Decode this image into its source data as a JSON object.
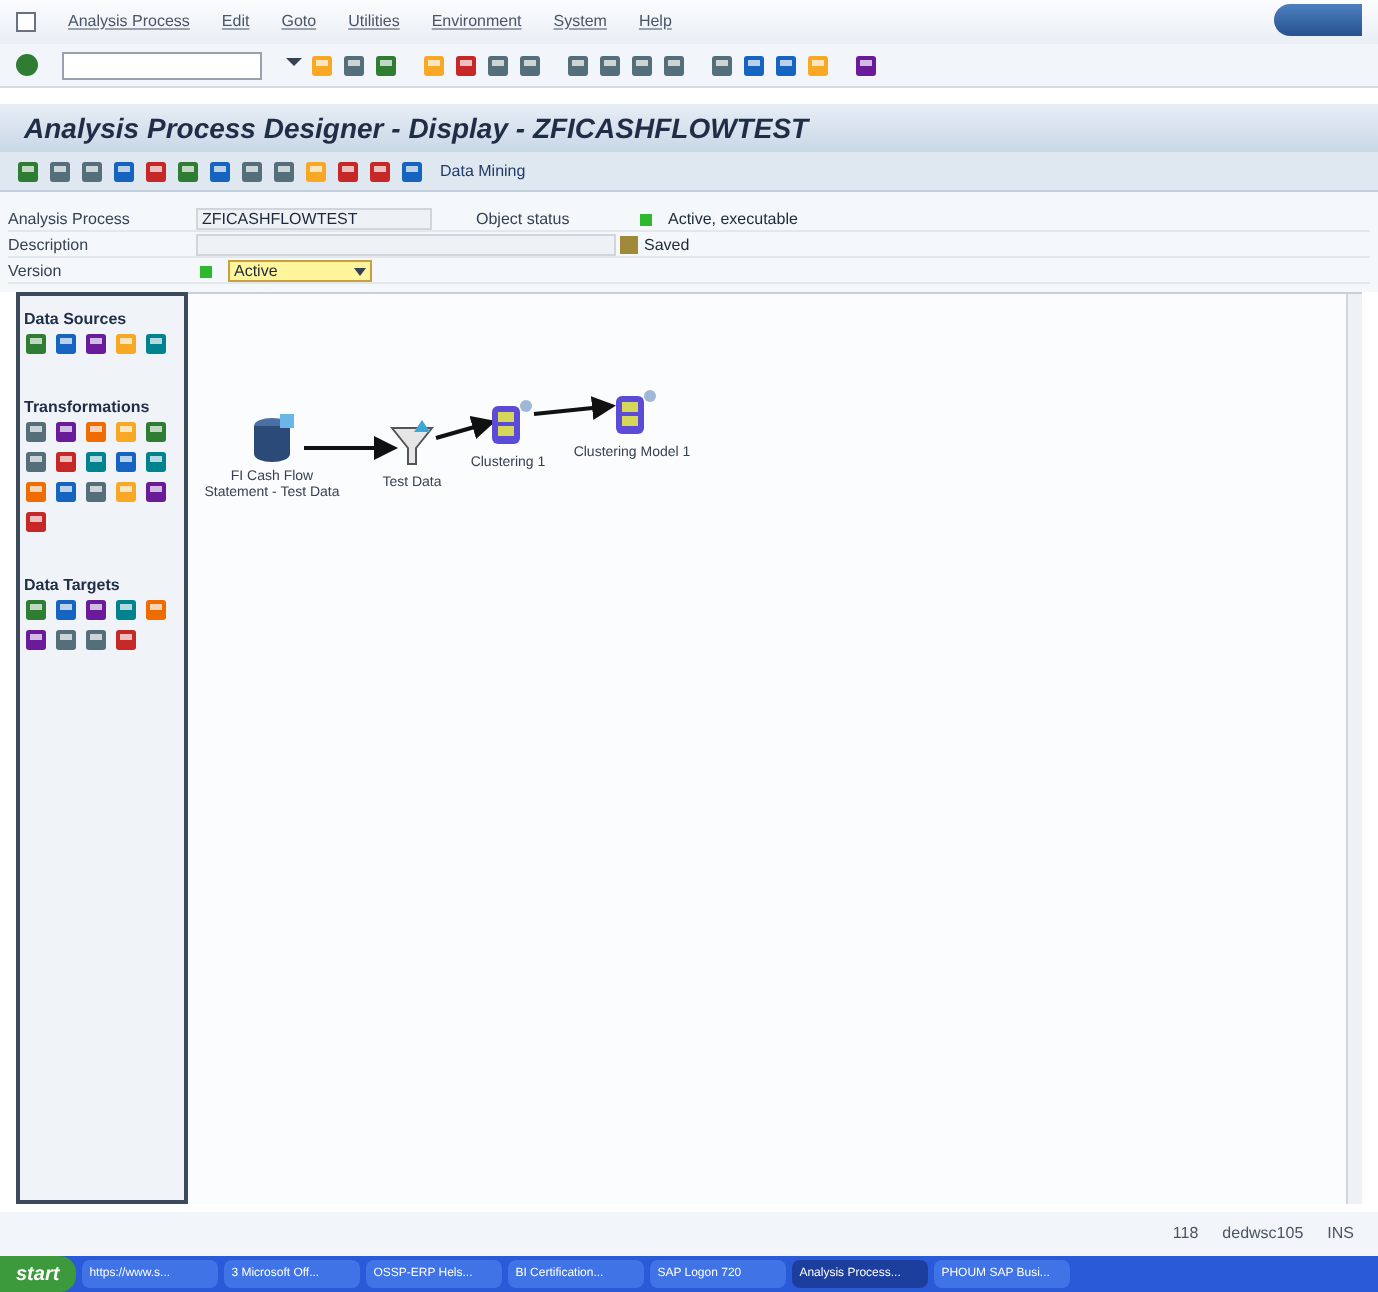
{
  "menu": [
    "Analysis Process",
    "Edit",
    "Goto",
    "Utilities",
    "Environment",
    "System",
    "Help"
  ],
  "title": "Analysis Process Designer - Display - ZFICASHFLOWTEST",
  "app_toolbar": {
    "data_mining_button": "Data Mining"
  },
  "form": {
    "analysis_process_label": "Analysis Process",
    "analysis_process_value": "ZFICASHFLOWTEST",
    "object_status_label": "Object status",
    "object_status": "Active, executable",
    "description_label": "Description",
    "save_state": "Saved",
    "version_label": "Version",
    "version_value": "Active"
  },
  "palette": [
    {
      "title": "Data Sources"
    },
    {
      "title": "Transformations"
    },
    {
      "title": "Data Targets"
    }
  ],
  "nodes": [
    {
      "kind": "source",
      "label": "FI Cash Flow Statement - Test Data"
    },
    {
      "kind": "filter",
      "label": "Test Data"
    },
    {
      "kind": "model",
      "label": "Clustering 1"
    },
    {
      "kind": "model",
      "label": "Clustering Model 1"
    }
  ],
  "status_bar": {
    "session": "118",
    "server": "dedwsc105",
    "mode": "INS"
  },
  "taskbar": {
    "start": "start",
    "tasks": [
      {
        "label": "https://www.s...",
        "selected": false
      },
      {
        "label": "3 Microsoft Off...",
        "selected": false
      },
      {
        "label": "OSSP-ERP Hels...",
        "selected": false
      },
      {
        "label": "BI Certification...",
        "selected": false
      },
      {
        "label": "SAP Logon 720",
        "selected": false
      },
      {
        "label": "Analysis Process...",
        "selected": true
      },
      {
        "label": "PHOUM SAP Busi...",
        "selected": false
      }
    ]
  }
}
